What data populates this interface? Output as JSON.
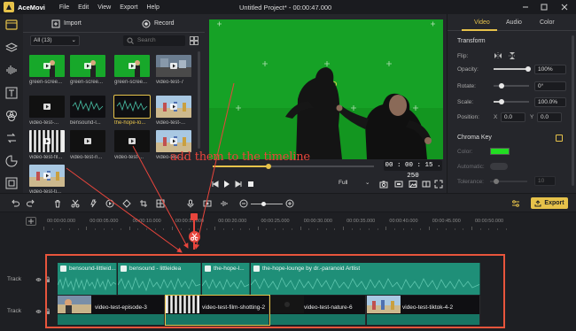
{
  "app": {
    "name": "AceMovi",
    "window_title": "Untitled Project* - 00:00:47.000",
    "menu": [
      "File",
      "Edit",
      "View",
      "Export",
      "Help"
    ]
  },
  "left_toolbar": [
    "media-icon",
    "layers-icon",
    "audio-icon",
    "text-icon",
    "filters-icon",
    "transitions-icon",
    "elements-icon",
    "templates-icon"
  ],
  "media": {
    "import_label": "Import",
    "record_label": "Record",
    "filter_value": "All (13)",
    "search_placeholder": "Search",
    "items": [
      {
        "label": "green-scree...",
        "kind": "video-green",
        "selected": false
      },
      {
        "label": "green-scree...",
        "kind": "video-green",
        "selected": false
      },
      {
        "label": "green-scree...",
        "kind": "video-green",
        "selected": false
      },
      {
        "label": "video-test-7",
        "kind": "video-street",
        "selected": false
      },
      {
        "label": "video-test-...",
        "kind": "video-dark",
        "selected": false
      },
      {
        "label": "bensound-l...",
        "kind": "audio",
        "selected": false
      },
      {
        "label": "the-hope-lo...",
        "kind": "audio",
        "selected": true
      },
      {
        "label": "video-test-...",
        "kind": "video-beach",
        "selected": false
      },
      {
        "label": "video-test-fil...",
        "kind": "video-film",
        "selected": false
      },
      {
        "label": "video-test-n...",
        "kind": "video-dark",
        "selected": false
      },
      {
        "label": "video-test-...",
        "kind": "video-dark",
        "selected": false
      },
      {
        "label": "video-test-...",
        "kind": "video-beach",
        "selected": false
      },
      {
        "label": "video-test-ti...",
        "kind": "video-beach",
        "selected": false
      }
    ]
  },
  "preview": {
    "timecode": "00 : 00 : 15 . 250",
    "zoom": "Full",
    "progress": 0.35
  },
  "annotation": "add them to the timeline",
  "properties": {
    "tabs": [
      "Video",
      "Audio",
      "Color"
    ],
    "active_tab": "Video",
    "transform_header": "Transform",
    "flip_label": "Flip:",
    "opacity_label": "Opacity:",
    "opacity_value": "100%",
    "opacity_level": 1.0,
    "rotate_label": "Rotate:",
    "rotate_value": "0°",
    "rotate_level": 0.0,
    "scale_label": "Scale:",
    "scale_value": "100.0%",
    "scale_level": 0.2,
    "position_label": "Position:",
    "position_x_label": "X",
    "position_x": "0.0",
    "position_y_label": "Y",
    "position_y": "0.0",
    "chroma_header": "Chroma Key",
    "color_label": "Color:",
    "chroma_color": "#22dd22",
    "automatic_label": "Automatic:",
    "tolerance_label": "Tolerance:",
    "tolerance_value": "10"
  },
  "timeline_toolbar": {
    "export_label": "Export"
  },
  "ruler_labels": [
    "00:00:00.000",
    "00:00:05.000",
    "00:00:10.000",
    "00:00:15.000",
    "00:00:20.000",
    "00:00:25.000",
    "00:00:30.000",
    "00:00:35.000",
    "00:00:40.000",
    "00:00:45.000",
    "00:00:50.000"
  ],
  "tracks": {
    "audio_label": "Track",
    "video_label": "Track",
    "audio_clips": [
      {
        "name": "bensound-littleid..."
      },
      {
        "name": "bensound - littleidea"
      },
      {
        "name": "the-hope-l..."
      },
      {
        "name": "the-hope-lounge by dr.-paranoid Artlist"
      }
    ],
    "video_clips": [
      {
        "name": "video-test-episode-3",
        "selected": false
      },
      {
        "name": "video-test-film-shotting-2",
        "selected": true
      },
      {
        "name": "video-test-nature-6",
        "selected": false
      },
      {
        "name": "video-test-tiktok-4-2",
        "selected": false
      }
    ]
  },
  "colors": {
    "accent": "#e6c24a",
    "annotation": "#e8453c",
    "audio_clip": "#1f8f78",
    "green_screen": "#15a125"
  }
}
